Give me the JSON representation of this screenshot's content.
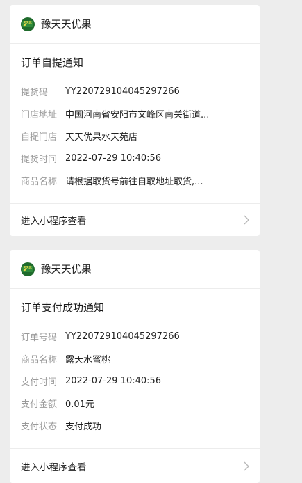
{
  "card1": {
    "brand": "豫天天优果",
    "logo_text": "天天优果",
    "title": "订单自提通知",
    "rows": [
      {
        "label": "提货码",
        "value": "YY220729104045297266"
      },
      {
        "label": "门店地址",
        "value": "中国河南省安阳市文峰区南关街道..."
      },
      {
        "label": "自提门店",
        "value": "天天优果水天苑店"
      },
      {
        "label": "提货时间",
        "value": "2022-07-29 10:40:56"
      },
      {
        "label": "商品名称",
        "value": "请根据取货号前往自取地址取货,..."
      }
    ],
    "footer_link": "进入小程序查看"
  },
  "card2": {
    "brand": "豫天天优果",
    "logo_text": "天天优果",
    "title": "订单支付成功通知",
    "rows": [
      {
        "label": "订单号码",
        "value": "YY220729104045297266"
      },
      {
        "label": "商品名称",
        "value": "露天水蜜桃"
      },
      {
        "label": "支付时间",
        "value": "2022-07-29 10:40:56"
      },
      {
        "label": "支付金额",
        "value": "0.01元"
      },
      {
        "label": "支付状态",
        "value": "支付成功"
      }
    ],
    "footer_link": "进入小程序查看"
  },
  "icons": {
    "logo": "brand-logo-icon",
    "chevron": "chevron-right-icon"
  },
  "colors": {
    "background": "#ededed",
    "card": "#ffffff",
    "label": "#9a9a9a",
    "logo_green": "#1f6b2c"
  }
}
